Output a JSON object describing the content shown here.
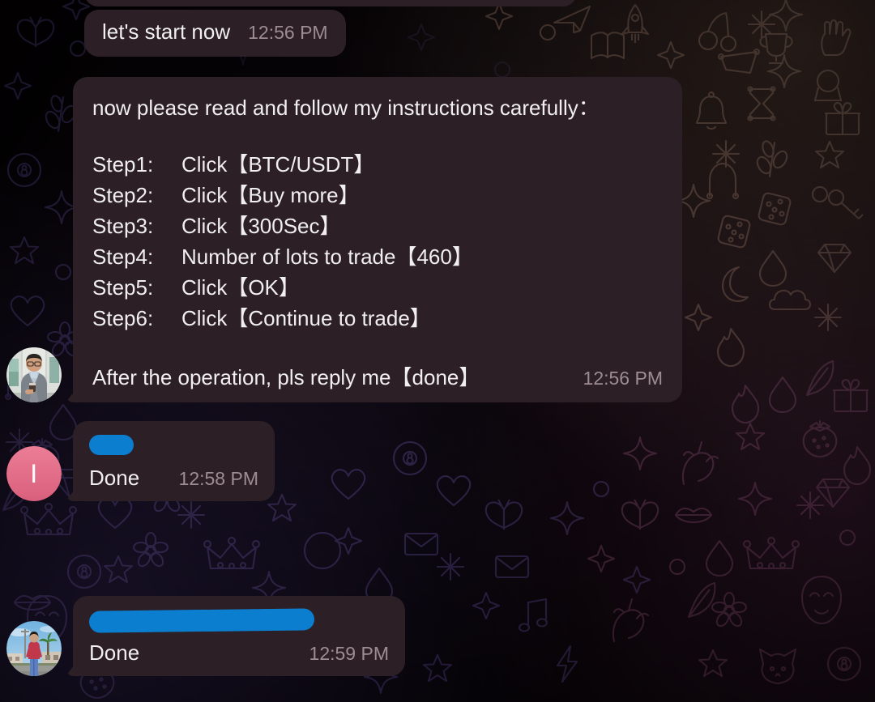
{
  "app": {
    "name": "telegram-chat",
    "bubble_color": "#2c1f25",
    "text_color": "#f0eef0",
    "time_color": "#9d8d93",
    "redaction_color": "#0b7ed0",
    "avatar_initial_color": "#e8728f"
  },
  "messages": [
    {
      "id": "msg-start",
      "text": "let's start now",
      "time": "12:56 PM",
      "sender": "other"
    },
    {
      "id": "msg-instructions",
      "header": "now please read and follow my instructions carefully：",
      "steps": [
        {
          "label": "Step1:",
          "action": "Click【BTC/USDT】"
        },
        {
          "label": "Step2:",
          "action": "Click【Buy more】"
        },
        {
          "label": "Step3:",
          "action": "Click【300Sec】"
        },
        {
          "label": "Step4:",
          "action": "Number of lots to trade【460】"
        },
        {
          "label": "Step5:",
          "action": "Click【OK】"
        },
        {
          "label": "Step6:",
          "action": "Click【Continue to trade】"
        }
      ],
      "footer": "After the operation, pls reply me【done】",
      "time": "12:56 PM",
      "sender": "other",
      "avatar": "photo-man-in-suit"
    },
    {
      "id": "msg-done-1",
      "redacted_label": "redacted-name-short",
      "text": "Done",
      "time": "12:58 PM",
      "sender": "other",
      "avatar_initial": "I"
    },
    {
      "id": "msg-done-2",
      "redacted_label": "redacted-name-long",
      "text": "Done",
      "time": "12:59 PM",
      "sender": "other",
      "avatar": "photo-person-outdoors"
    }
  ]
}
